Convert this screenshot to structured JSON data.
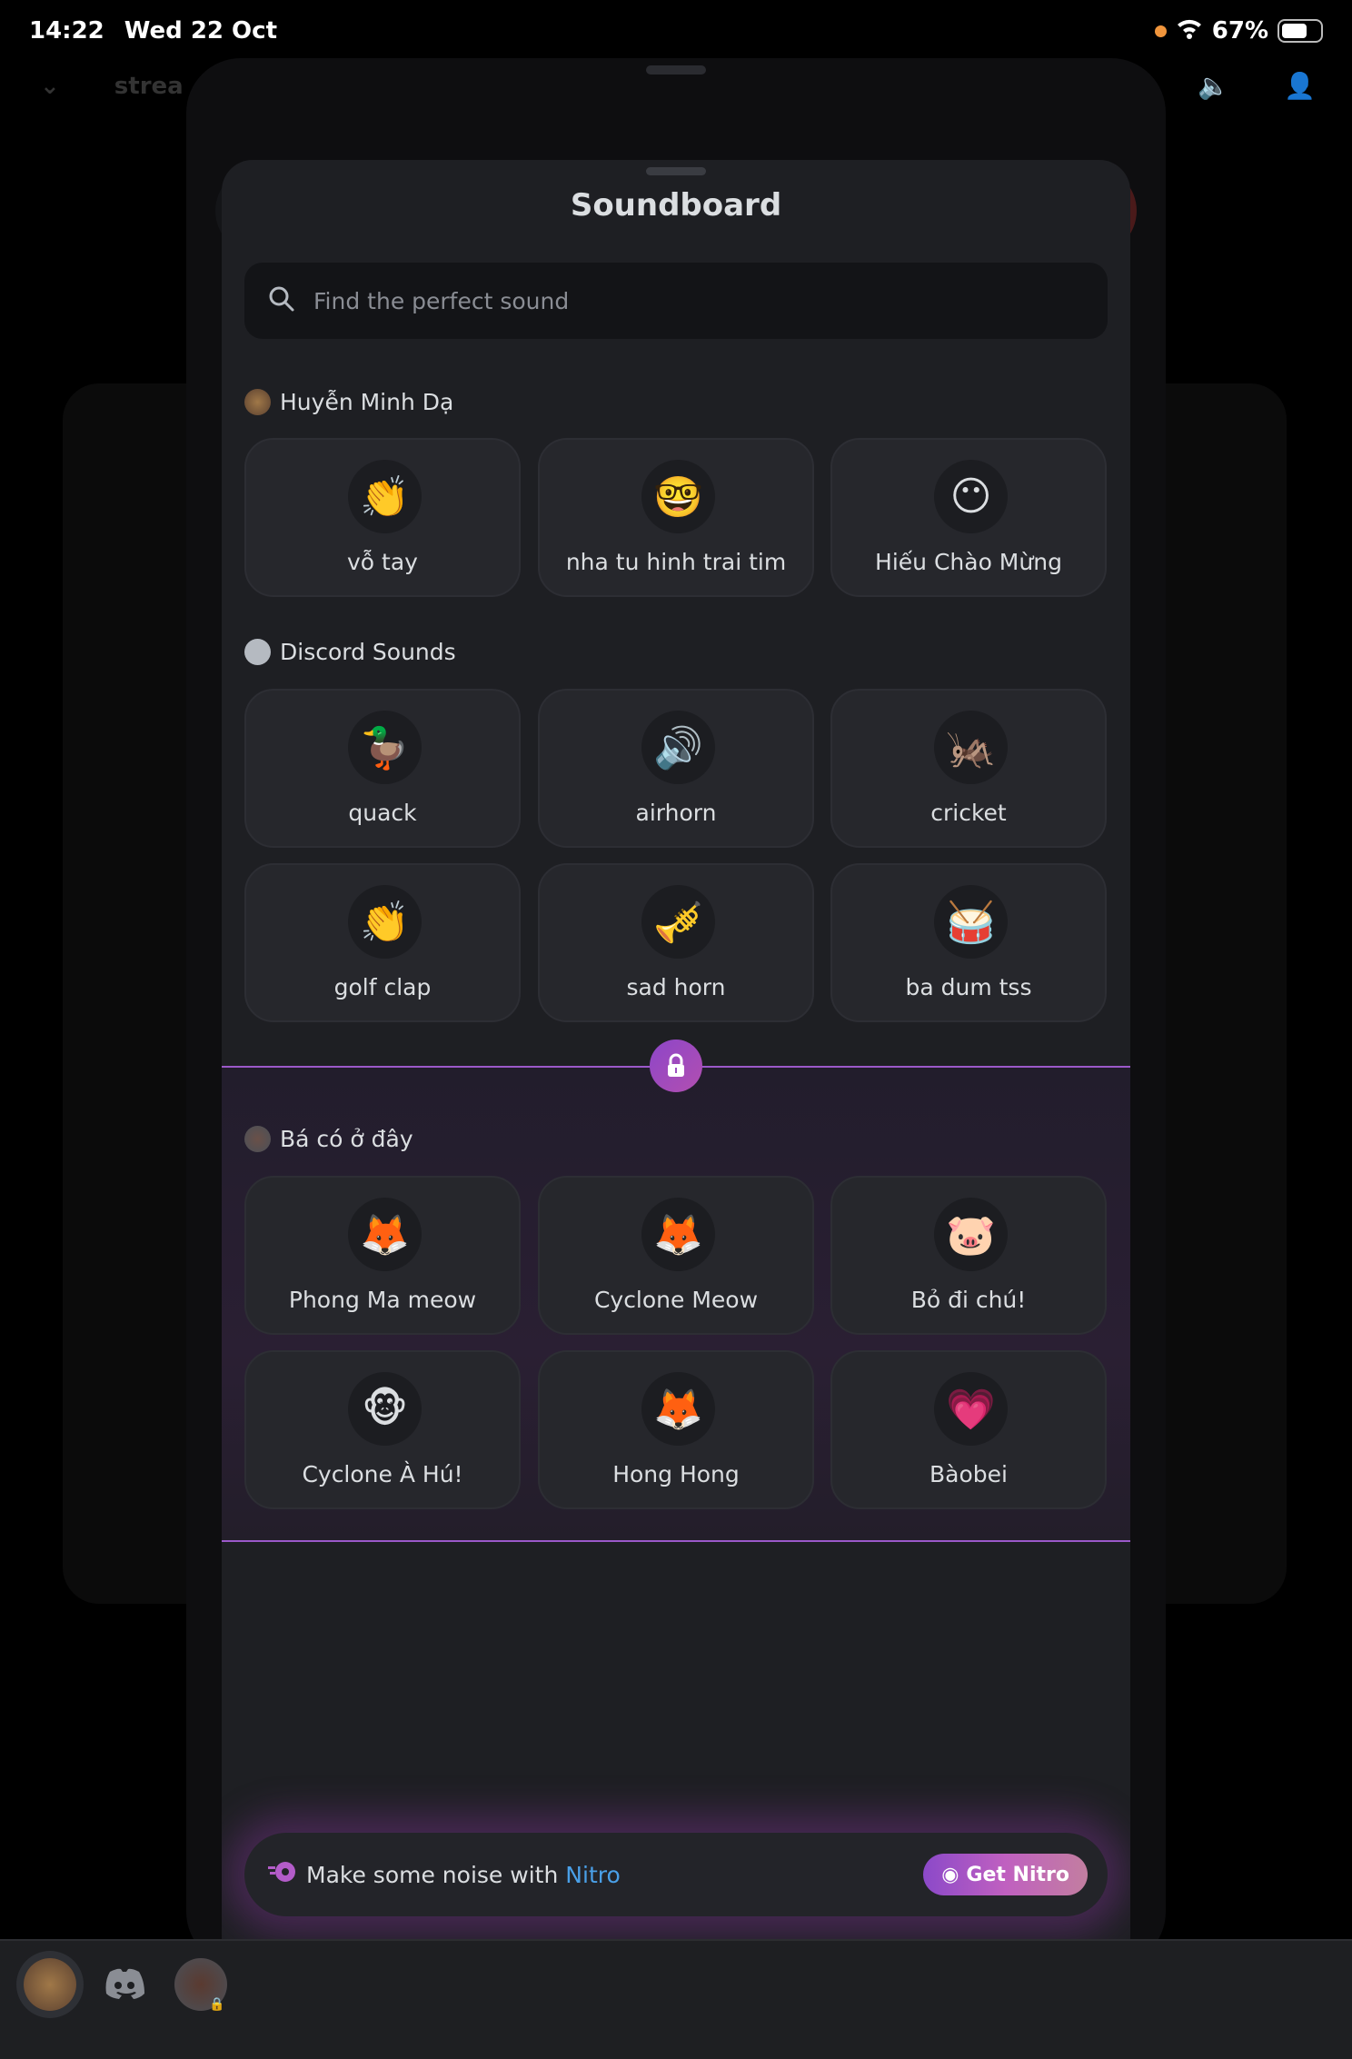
{
  "status_bar": {
    "time": "14:22",
    "date": "Wed 22 Oct",
    "battery": "67%",
    "battery_level": 0.67
  },
  "background": {
    "channel_name": "strea"
  },
  "soundboard": {
    "title": "Soundboard",
    "search": {
      "placeholder": "Find the perfect sound",
      "value": ""
    },
    "sections": [
      {
        "name": "Huyễn Minh Dạ",
        "avatar": "server-avatar",
        "locked": false,
        "sounds": [
          {
            "label": "vỗ tay",
            "icon": "clapping-hands",
            "glyph": "👏"
          },
          {
            "label": "nha tu hinh trai tim",
            "icon": "sketch-face",
            "glyph": "🤓"
          },
          {
            "label": "Hiếu Chào Mừng",
            "icon": "blank-face",
            "glyph": "😶"
          }
        ]
      },
      {
        "name": "Discord Sounds",
        "avatar": "discord-logo",
        "locked": false,
        "sounds": [
          {
            "label": "quack",
            "icon": "duck",
            "glyph": "🦆"
          },
          {
            "label": "airhorn",
            "icon": "speaker",
            "glyph": "🔊"
          },
          {
            "label": "cricket",
            "icon": "cricket",
            "glyph": "🦗"
          },
          {
            "label": "golf clap",
            "icon": "clapping-hands",
            "glyph": "👏"
          },
          {
            "label": "sad horn",
            "icon": "trumpet",
            "glyph": "🎺"
          },
          {
            "label": "ba dum tss",
            "icon": "drum",
            "glyph": "🥁"
          }
        ]
      },
      {
        "name": "Bá có ở đây",
        "avatar": "server-avatar",
        "locked": true,
        "sounds": [
          {
            "label": "Phong Ma meow",
            "icon": "flareon-sticker",
            "glyph": "🦊"
          },
          {
            "label": "Cyclone Meow",
            "icon": "flareon-sticker",
            "glyph": "🦊"
          },
          {
            "label": "Bỏ đi chú!",
            "icon": "slowpoke-sticker",
            "glyph": "🐷"
          },
          {
            "label": "Cyclone À Hú!",
            "icon": "monkey-sticker",
            "glyph": "🐵"
          },
          {
            "label": "Hong Hong",
            "icon": "flareon-sticker",
            "glyph": "🦊"
          },
          {
            "label": "Bàobei",
            "icon": "mew-heart-sticker",
            "glyph": "💗"
          }
        ]
      }
    ],
    "nitro_banner": {
      "text": "Make some noise with",
      "link": "Nitro",
      "button": "Get Nitro"
    }
  },
  "colors": {
    "accent_purple": "#9b59c9",
    "nitro_link": "#4aa0e8",
    "sheet_bg": "#1e1f23",
    "tile_bg": "#26272c"
  }
}
